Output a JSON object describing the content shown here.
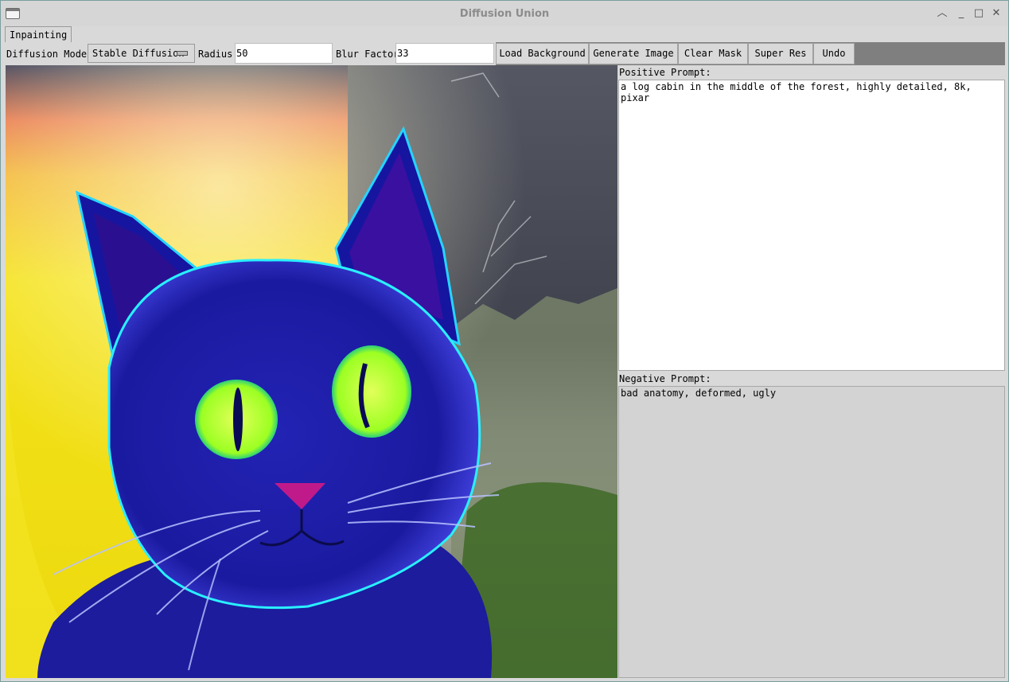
{
  "window": {
    "title": "Diffusion Union"
  },
  "tabs": [
    {
      "label": "Inpainting"
    }
  ],
  "toolbar": {
    "model_label": "Diffusion Model:",
    "model_value": "Stable Diffusion",
    "radius_label": "Radius:",
    "radius_value": "50",
    "blur_label": "Blur Factor:",
    "blur_value": "33",
    "buttons": {
      "load_background": "Load Background",
      "generate_image": "Generate Image",
      "clear_mask": "Clear Mask",
      "super_res": "Super Res",
      "undo": "Undo"
    }
  },
  "prompts": {
    "positive_label": "Positive Prompt:",
    "positive_text": "a log cabin in the middle of the forest, highly detailed, 8k, pixar",
    "negative_label": "Negative Prompt:",
    "negative_text": "bad anatomy, deformed, ugly"
  },
  "icons": [
    "app-window-icon",
    "chevron-up-icon",
    "minimize-icon",
    "maximize-icon",
    "close-icon"
  ],
  "colors": {
    "toolbar_bg": "#7f7f7f",
    "panel_bg": "#d9d9d9",
    "cat_blue": "#1a1aa8",
    "cat_eyes": "#b6ff1f"
  }
}
